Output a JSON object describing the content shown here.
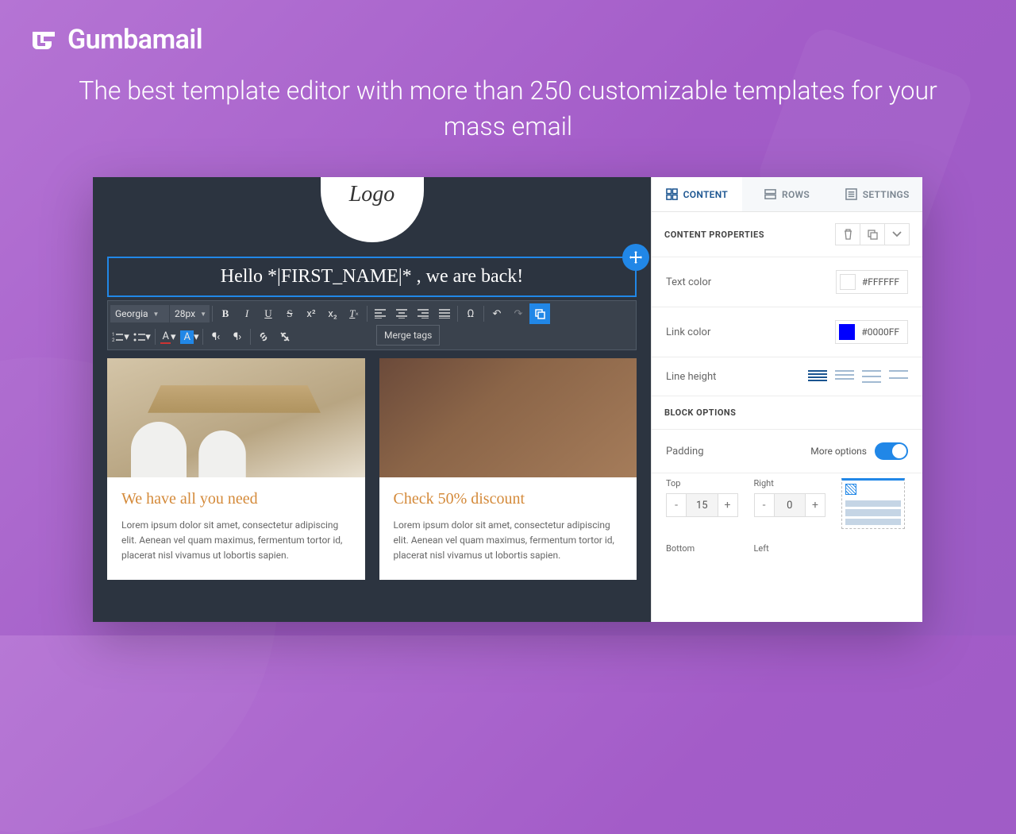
{
  "brand": "Gumbamail",
  "tagline": "The best template editor with more than 250 customizable templates for your mass email",
  "canvas": {
    "logo_text": "Logo",
    "headline": "Hello *|FIRST_NAME|* , we are back!",
    "toolbar": {
      "font": "Georgia",
      "size": "28px",
      "merge_tags_tip": "Merge tags"
    },
    "cards": [
      {
        "title": "We have all you need",
        "body": "Lorem ipsum dolor sit amet, consectetur adipiscing elit. Aenean vel quam maximus, fermentum tortor id, placerat nisl vivamus ut lobortis sapien."
      },
      {
        "title": "Check 50% discount",
        "body": "Lorem ipsum dolor sit amet, consectetur adipiscing elit. Aenean vel quam maximus, fermentum tortor id, placerat nisl vivamus ut lobortis sapien."
      }
    ]
  },
  "panel": {
    "tabs": {
      "content": "CONTENT",
      "rows": "ROWS",
      "settings": "SETTINGS"
    },
    "section_props": "CONTENT PROPERTIES",
    "text_color": {
      "label": "Text color",
      "value": "#FFFFFF"
    },
    "link_color": {
      "label": "Link color",
      "value": "#0000FF"
    },
    "line_height": {
      "label": "Line height"
    },
    "section_block": "BLOCK OPTIONS",
    "padding": {
      "label": "Padding",
      "more": "More options"
    },
    "sides": {
      "top": {
        "label": "Top",
        "value": "15"
      },
      "right": {
        "label": "Right",
        "value": "0"
      },
      "bottom": {
        "label": "Bottom"
      },
      "left": {
        "label": "Left"
      }
    }
  }
}
